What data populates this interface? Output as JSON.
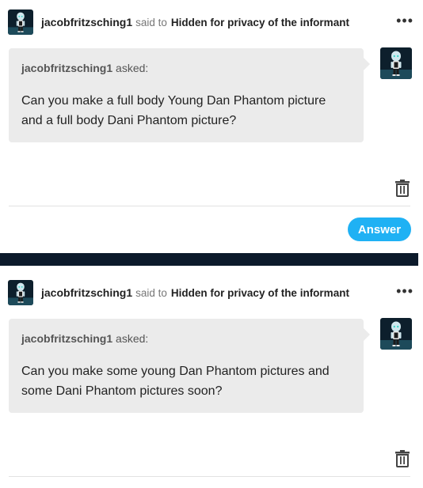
{
  "posts": [
    {
      "username": "jacobfritzsching1",
      "said_to": "said to",
      "recipient": "Hidden for privacy of the informant",
      "asked_user": "jacobfritzsching1",
      "asked_suffix": "asked:",
      "question_line1": "Can you make a full body Young Dan Phantom picture",
      "question_line2": "and a full body Dani Phantom picture?",
      "answer_label": "Answer"
    },
    {
      "username": "jacobfritzsching1",
      "said_to": "said to",
      "recipient": "Hidden for privacy of the informant",
      "asked_user": "jacobfritzsching1",
      "asked_suffix": "asked:",
      "question_line1": "Can you make some young Dan Phantom pictures and",
      "question_line2": "some Dani Phantom pictures soon?"
    }
  ],
  "icons": {
    "more": "more-dots-icon",
    "delete": "trash-icon",
    "avatar": "avatar"
  },
  "colors": {
    "answer_button": "#1fb1f4",
    "bubble": "#ebebeb",
    "separator": "#0c1a2b"
  }
}
